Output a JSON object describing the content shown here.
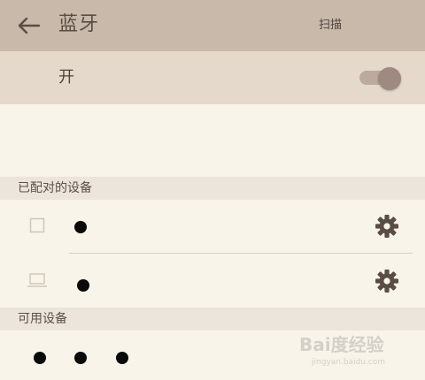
{
  "header": {
    "title": "蓝牙",
    "scan_label": "扫描"
  },
  "bluetooth_toggle": {
    "label": "开",
    "state": "on"
  },
  "paired_section": {
    "title": "已配对的设备",
    "devices": [
      {
        "name": "",
        "icon": "phone-icon"
      },
      {
        "name": "",
        "icon": "laptop-icon"
      }
    ]
  },
  "available_section": {
    "title": "可用设备"
  },
  "watermark": {
    "text": "Bai度经验",
    "sub": "jingyan.baidu.com"
  }
}
